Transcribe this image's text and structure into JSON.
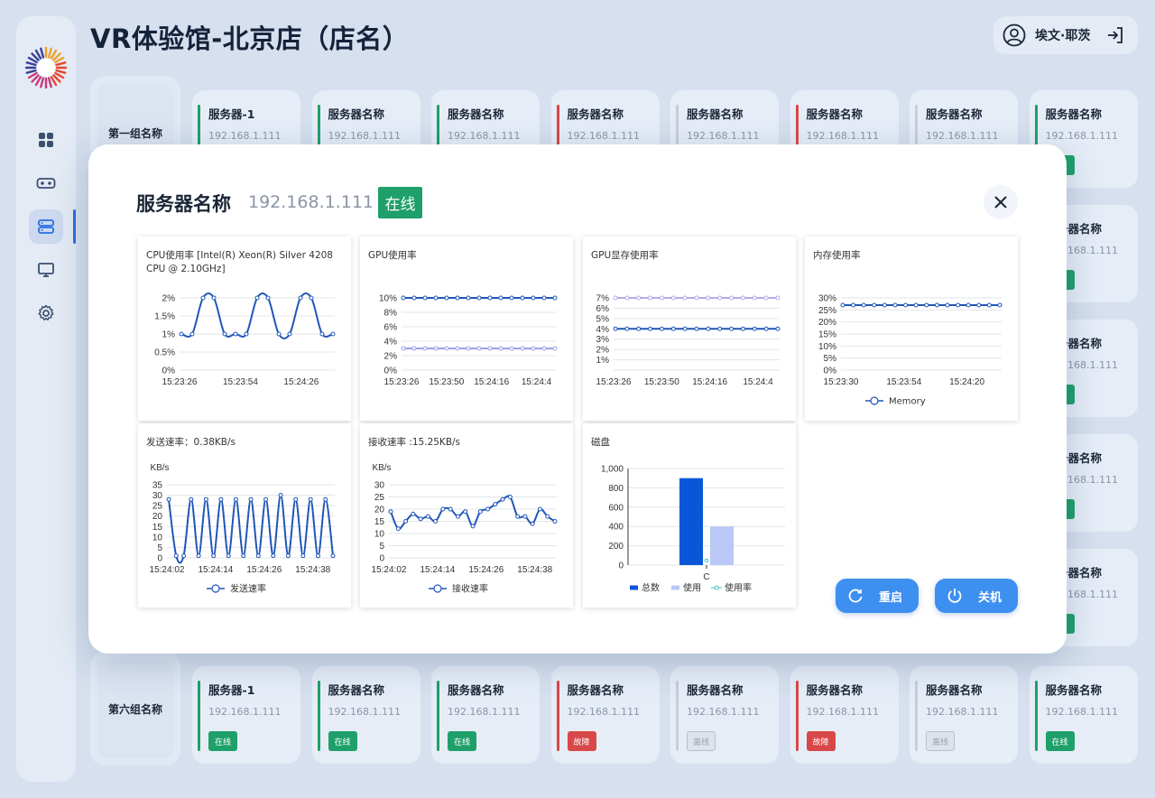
{
  "app": {
    "title": "VR体验馆-北京店（店名）"
  },
  "user": {
    "name": "埃文·耶茨"
  },
  "nav": {
    "items": [
      {
        "id": "dashboard",
        "icon": "grid-icon",
        "active": false
      },
      {
        "id": "vr",
        "icon": "vr-headset-icon",
        "active": false
      },
      {
        "id": "servers",
        "icon": "server-icon",
        "active": true
      },
      {
        "id": "monitor",
        "icon": "monitor-icon",
        "active": false
      },
      {
        "id": "settings",
        "icon": "gear-icon",
        "active": false
      }
    ]
  },
  "status_colors": {
    "online": "#1fa06a",
    "fault": "#d94848",
    "offline": "#c8ced8"
  },
  "groups": [
    {
      "label": "第一组名称",
      "cards": [
        {
          "name": "服务器-1",
          "ip": "192.168.1.111",
          "status": "online"
        },
        {
          "name": "服务器名称",
          "ip": "192.168.1.111",
          "status": "online"
        },
        {
          "name": "服务器名称",
          "ip": "192.168.1.111",
          "status": "online"
        },
        {
          "name": "服务器名称",
          "ip": "192.168.1.111",
          "status": "fault"
        },
        {
          "name": "服务器名称",
          "ip": "192.168.1.111",
          "status": "offline"
        },
        {
          "name": "服务器名称",
          "ip": "192.168.1.111",
          "status": "fault"
        },
        {
          "name": "服务器名称",
          "ip": "192.168.1.111",
          "status": "offline"
        },
        {
          "name": "服务器名称",
          "ip": "192.168.1.111",
          "status": "online",
          "badge": ""
        }
      ]
    },
    {
      "label": "",
      "cards": [
        {
          "name": "服务器名称",
          "ip": "192.168.1.111",
          "status": "online",
          "badge": ""
        }
      ]
    },
    {
      "label": "",
      "cards": [
        {
          "name": "服务器名称",
          "ip": "192.168.1.111",
          "status": "online",
          "badge": ""
        }
      ]
    },
    {
      "label": "",
      "cards": [
        {
          "name": "服务器名称",
          "ip": "192.168.1.111",
          "status": "online",
          "badge": ""
        }
      ]
    },
    {
      "label": "",
      "cards": [
        {
          "name": "服务器名称",
          "ip": "192.168.1.111",
          "status": "online",
          "badge": ""
        }
      ]
    },
    {
      "label": "第六组名称",
      "cards": [
        {
          "name": "服务器-1",
          "ip": "192.168.1.111",
          "status": "online",
          "badge": "在线"
        },
        {
          "name": "服务器名称",
          "ip": "192.168.1.111",
          "status": "online",
          "badge": "在线"
        },
        {
          "name": "服务器名称",
          "ip": "192.168.1.111",
          "status": "online",
          "badge": "在线"
        },
        {
          "name": "服务器名称",
          "ip": "192.168.1.111",
          "status": "fault",
          "badge": "故障"
        },
        {
          "name": "服务器名称",
          "ip": "192.168.1.111",
          "status": "offline",
          "badge": "离线"
        },
        {
          "name": "服务器名称",
          "ip": "192.168.1.111",
          "status": "fault",
          "badge": "故障"
        },
        {
          "name": "服务器名称",
          "ip": "192.168.1.111",
          "status": "offline",
          "badge": "离线"
        },
        {
          "name": "服务器名称",
          "ip": "192.168.1.111",
          "status": "online",
          "badge": "在线"
        }
      ]
    }
  ],
  "modal": {
    "title": "服务器名称",
    "ip": "192.168.1.111",
    "status": "在线",
    "restart_label": "重启",
    "shutdown_label": "关机"
  },
  "chart_data": [
    {
      "id": "cpu",
      "type": "line",
      "title": "CPU使用率 [Intel(R) Xeon(R) Silver 4208 CPU @ 2.10GHz]",
      "yticks": [
        "0%",
        "0.5%",
        "1%",
        "1.5%",
        "2%"
      ],
      "ylim": [
        0,
        2
      ],
      "xticks": [
        "15:23:26",
        "15:23:54",
        "15:24:26"
      ],
      "series": [
        {
          "color": "#1f56b8",
          "smooth": true,
          "values": [
            1,
            1,
            2,
            2,
            1,
            1,
            1,
            2,
            2,
            1,
            1,
            2,
            2,
            1,
            1
          ]
        }
      ]
    },
    {
      "id": "gpu",
      "type": "line",
      "title": "GPU使用率",
      "yticks": [
        "0%",
        "2%",
        "4%",
        "6%",
        "8%",
        "10%"
      ],
      "ylim": [
        0,
        10
      ],
      "xticks": [
        "15:23:26",
        "15:23:50",
        "15:24:16",
        "15:24:4"
      ],
      "series": [
        {
          "color": "#1f56b8",
          "values": [
            10,
            10,
            10,
            10,
            10,
            10,
            10,
            10,
            10,
            10,
            10,
            10,
            10,
            10,
            10
          ]
        },
        {
          "color": "#9aa2e8",
          "values": [
            3,
            3,
            3,
            3,
            3,
            3,
            3,
            3,
            3,
            3,
            3,
            3,
            3,
            3,
            3
          ]
        }
      ]
    },
    {
      "id": "gpu-mem",
      "type": "line",
      "title": "GPU显存使用率",
      "yticks": [
        "1%",
        "2%",
        "3%",
        "4%",
        "5%",
        "6%",
        "7%"
      ],
      "ylim": [
        0,
        7
      ],
      "xticks": [
        "15:23:26",
        "15:23:50",
        "15:24:16",
        "15:24:4"
      ],
      "series": [
        {
          "color": "#1f56b8",
          "values": [
            4,
            4,
            4,
            4,
            4,
            4,
            4,
            4,
            4,
            4,
            4,
            4,
            4,
            4,
            4
          ]
        },
        {
          "color": "#b9a8e8",
          "values": [
            7,
            7,
            7,
            7,
            7,
            7,
            7,
            7,
            7,
            7,
            7,
            7,
            7,
            7,
            7
          ]
        }
      ]
    },
    {
      "id": "mem",
      "type": "line",
      "title": "内存使用率",
      "yticks": [
        "0%",
        "5%",
        "10%",
        "15%",
        "20%",
        "25%",
        "30%"
      ],
      "ylim": [
        0,
        30
      ],
      "xticks": [
        "15:23:30",
        "15:23:54",
        "15:24:20"
      ],
      "legend": [
        "Memory"
      ],
      "series": [
        {
          "name": "Memory",
          "color": "#1f56b8",
          "values": [
            27,
            27,
            27,
            27,
            27,
            27,
            27,
            27,
            27,
            27,
            27,
            27,
            27,
            27,
            27,
            27
          ]
        }
      ]
    },
    {
      "id": "send",
      "type": "line",
      "title": "发送速率：0.38KB/s",
      "ylabel": "KB/s",
      "yticks": [
        "0",
        "5",
        "10",
        "15",
        "20",
        "25",
        "30",
        "35"
      ],
      "ylim": [
        0,
        35
      ],
      "xticks": [
        "15:24:02",
        "15:24:14",
        "15:24:26",
        "15:24:38"
      ],
      "legend": [
        "发送速率"
      ],
      "series": [
        {
          "name": "发送速率",
          "color": "#1f56b8",
          "smooth": true,
          "values": [
            28,
            1,
            1,
            28,
            1,
            28,
            1,
            28,
            1,
            28,
            1,
            28,
            1,
            28,
            1,
            30,
            1,
            28,
            1,
            28,
            1,
            28,
            1
          ]
        }
      ]
    },
    {
      "id": "recv",
      "type": "line",
      "title": "接收速率 :15.25KB/s",
      "ylabel": "KB/s",
      "yticks": [
        "0",
        "5",
        "10",
        "15",
        "20",
        "25",
        "30"
      ],
      "ylim": [
        0,
        30
      ],
      "xticks": [
        "15:24:02",
        "15:24:14",
        "15:24:26",
        "15:24:38"
      ],
      "legend": [
        "接收速率"
      ],
      "series": [
        {
          "name": "接收速率",
          "color": "#1f56b8",
          "smooth": true,
          "values": [
            19,
            12,
            15,
            18,
            16,
            17,
            15,
            20,
            20,
            17,
            19,
            13,
            19,
            20,
            22,
            24,
            25,
            17,
            17,
            14,
            20,
            17,
            15
          ]
        }
      ]
    },
    {
      "id": "disk",
      "type": "bar",
      "title": "磁盘",
      "yticks": [
        "0",
        "200",
        "400",
        "600",
        "800",
        "1,000"
      ],
      "ylim": [
        0,
        1000
      ],
      "categories": [
        "C"
      ],
      "legend": [
        "总数",
        "使用",
        "使用率"
      ],
      "series": [
        {
          "name": "总数",
          "color": "#0a56d8",
          "values": [
            900
          ]
        },
        {
          "name": "使用",
          "color": "#b9c8f6",
          "values": [
            400
          ]
        },
        {
          "name": "使用率",
          "color": "#3fc6c6",
          "values": [
            44
          ]
        }
      ]
    }
  ]
}
